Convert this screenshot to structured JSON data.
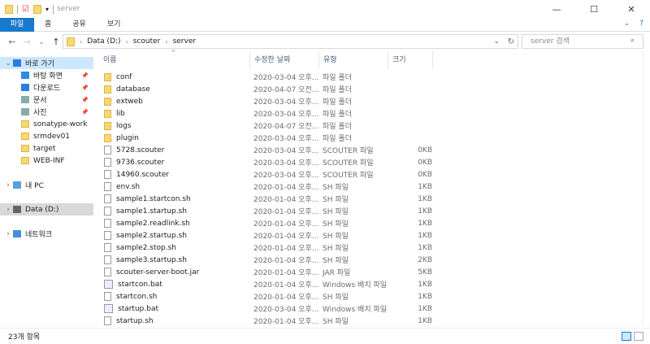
{
  "window": {
    "title": "server",
    "minimize": "—",
    "maximize": "☐",
    "close": "✕"
  },
  "ribbon": {
    "tabs": [
      "파일",
      "홈",
      "공유",
      "보기"
    ],
    "collapse": "⌄",
    "help": "?"
  },
  "nav": {
    "back": "←",
    "forward": "→",
    "recent": "⌄",
    "up": "↑",
    "path": [
      "Data (D:)",
      "scouter",
      "server"
    ],
    "dropdown": "⌄",
    "refresh": "↻",
    "search_placeholder": "server 검색"
  },
  "sidebar": [
    {
      "label": "바로 가기",
      "type": "star",
      "level": 0,
      "expander": "⌄",
      "selected": true
    },
    {
      "label": "바탕 화면",
      "type": "desktop",
      "level": 1,
      "pinned": true
    },
    {
      "label": "다운로드",
      "type": "download",
      "level": 1,
      "pinned": true
    },
    {
      "label": "문서",
      "type": "doc",
      "level": 1,
      "pinned": true
    },
    {
      "label": "사진",
      "type": "pic",
      "level": 1,
      "pinned": true
    },
    {
      "label": "sonatype-work",
      "type": "folder",
      "level": 1
    },
    {
      "label": "srmdev01",
      "type": "folder",
      "level": 1
    },
    {
      "label": "target",
      "type": "folder",
      "level": 1
    },
    {
      "label": "WEB-INF",
      "type": "folder",
      "level": 1
    },
    {
      "label": "",
      "type": "gap",
      "level": 0
    },
    {
      "label": "내 PC",
      "type": "pc",
      "level": 0,
      "expander": "›"
    },
    {
      "label": "",
      "type": "gap",
      "level": 0
    },
    {
      "label": "Data (D:)",
      "type": "drive",
      "level": 0,
      "expander": "›",
      "selected2": true
    },
    {
      "label": "",
      "type": "gap",
      "level": 0
    },
    {
      "label": "네트워크",
      "type": "net",
      "level": 0,
      "expander": "›"
    }
  ],
  "columns": {
    "name": "이름",
    "date": "수정한 날짜",
    "type": "유형",
    "size": "크기"
  },
  "files": [
    {
      "name": "conf",
      "date": "2020-03-04 오후...",
      "type": "파일 폴더",
      "size": "",
      "icon": "folder"
    },
    {
      "name": "database",
      "date": "2020-04-07 오전...",
      "type": "파일 폴더",
      "size": "",
      "icon": "folder"
    },
    {
      "name": "extweb",
      "date": "2020-03-04 오후...",
      "type": "파일 폴더",
      "size": "",
      "icon": "folder"
    },
    {
      "name": "lib",
      "date": "2020-03-04 오후...",
      "type": "파일 폴더",
      "size": "",
      "icon": "folder"
    },
    {
      "name": "logs",
      "date": "2020-04-07 오전...",
      "type": "파일 폴더",
      "size": "",
      "icon": "folder"
    },
    {
      "name": "plugin",
      "date": "2020-03-04 오후...",
      "type": "파일 폴더",
      "size": "",
      "icon": "folder"
    },
    {
      "name": "5728.scouter",
      "date": "2020-03-04 오후...",
      "type": "SCOUTER 파일",
      "size": "0KB",
      "icon": "file"
    },
    {
      "name": "9736.scouter",
      "date": "2020-03-04 오후...",
      "type": "SCOUTER 파일",
      "size": "0KB",
      "icon": "file"
    },
    {
      "name": "14960.scouter",
      "date": "2020-03-04 오후...",
      "type": "SCOUTER 파일",
      "size": "0KB",
      "icon": "file"
    },
    {
      "name": "env.sh",
      "date": "2020-01-04 오후...",
      "type": "SH 파일",
      "size": "1KB",
      "icon": "file"
    },
    {
      "name": "sample1.startcon.sh",
      "date": "2020-01-04 오후...",
      "type": "SH 파일",
      "size": "1KB",
      "icon": "file"
    },
    {
      "name": "sample1.startup.sh",
      "date": "2020-01-04 오후...",
      "type": "SH 파일",
      "size": "1KB",
      "icon": "file"
    },
    {
      "name": "sample2.readlink.sh",
      "date": "2020-01-04 오후...",
      "type": "SH 파일",
      "size": "1KB",
      "icon": "file"
    },
    {
      "name": "sample2.startup.sh",
      "date": "2020-01-04 오후...",
      "type": "SH 파일",
      "size": "1KB",
      "icon": "file"
    },
    {
      "name": "sample2.stop.sh",
      "date": "2020-01-04 오후...",
      "type": "SH 파일",
      "size": "1KB",
      "icon": "file"
    },
    {
      "name": "sample3.startup.sh",
      "date": "2020-01-04 오후...",
      "type": "SH 파일",
      "size": "2KB",
      "icon": "file"
    },
    {
      "name": "scouter-server-boot.jar",
      "date": "2020-01-04 오후...",
      "type": "JAR 파일",
      "size": "5KB",
      "icon": "file"
    },
    {
      "name": "startcon.bat",
      "date": "2020-01-04 오후...",
      "type": "Windows 배치 파일",
      "size": "1KB",
      "icon": "bat"
    },
    {
      "name": "startcon.sh",
      "date": "2020-01-04 오후...",
      "type": "SH 파일",
      "size": "1KB",
      "icon": "file"
    },
    {
      "name": "startup.bat",
      "date": "2020-03-04 오후...",
      "type": "Windows 배치 파일",
      "size": "1KB",
      "icon": "bat"
    },
    {
      "name": "startup.sh",
      "date": "2020-01-04 오후...",
      "type": "SH 파일",
      "size": "1KB",
      "icon": "file"
    }
  ],
  "status": {
    "count": "23개 항목"
  }
}
